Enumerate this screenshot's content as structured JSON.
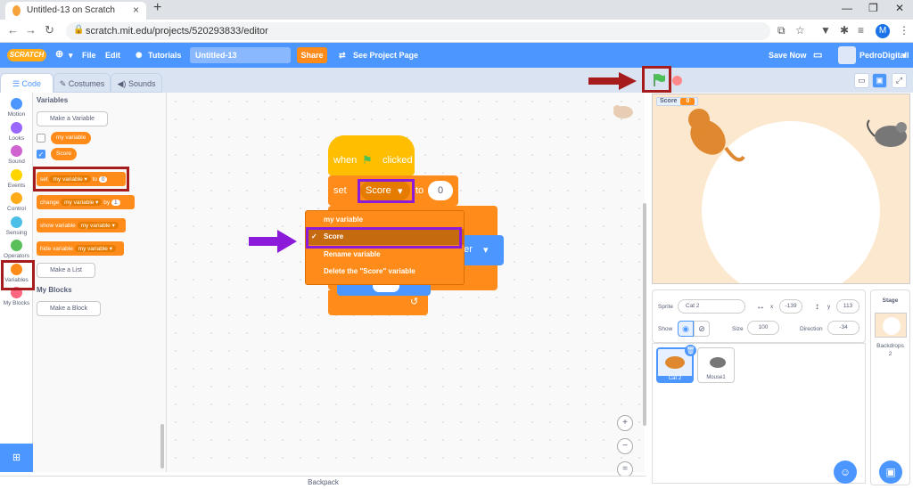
{
  "browser": {
    "tab_title": "Untitled-13 on Scratch",
    "tab_close": "×",
    "new_tab": "+",
    "minimize": "—",
    "restore": "❐",
    "close": "✕",
    "url": "scratch.mit.edu/projects/520293833/editor",
    "profile_initial": "M"
  },
  "menubar": {
    "logo": "SCRATCH",
    "file": "File",
    "edit": "Edit",
    "tutorials": "Tutorials",
    "project_name": "Untitled-13",
    "share": "Share",
    "see_project": "See Project Page",
    "save_now": "Save Now",
    "username": "PedroDigitall"
  },
  "editor_tabs": {
    "code": "Code",
    "costumes": "Costumes",
    "sounds": "Sounds"
  },
  "categories": [
    {
      "label": "Motion",
      "color": "#4c97ff"
    },
    {
      "label": "Looks",
      "color": "#9966ff"
    },
    {
      "label": "Sound",
      "color": "#cf63cf"
    },
    {
      "label": "Events",
      "color": "#ffd500"
    },
    {
      "label": "Control",
      "color": "#ffab19"
    },
    {
      "label": "Sensing",
      "color": "#4cbfe6"
    },
    {
      "label": "Operators",
      "color": "#59c059"
    },
    {
      "label": "Variables",
      "color": "#ff8c1a"
    },
    {
      "label": "My Blocks",
      "color": "#ff6680"
    }
  ],
  "palette": {
    "variables_title": "Variables",
    "make_variable": "Make a Variable",
    "var1": "my variable",
    "var2": "Score",
    "set_word": "set",
    "set_var": "my variable",
    "to_word": "to",
    "set_value": "0",
    "change_word": "change",
    "change_var": "my variable",
    "by_word": "by",
    "change_value": "1",
    "show_word": "show variable",
    "show_var": "my variable",
    "hide_word": "hide variable",
    "hide_var": "my variable",
    "make_list": "Make a List",
    "myblocks_title": "My Blocks",
    "make_block": "Make a Block"
  },
  "script": {
    "when": "when",
    "clicked": "clicked",
    "set": "set",
    "variable": "Score",
    "to": "to",
    "value": "0",
    "goto_partial": "nter"
  },
  "dropdown": {
    "items": [
      {
        "label": "my variable",
        "check": ""
      },
      {
        "label": "Score",
        "check": "✓"
      },
      {
        "label": "Rename variable",
        "check": ""
      },
      {
        "label": "Delete the \"Score\" variable",
        "check": ""
      }
    ]
  },
  "stage": {
    "monitor_label": "Score",
    "monitor_value": "0"
  },
  "sprite_info": {
    "sprite_label": "Sprite",
    "sprite_name": "Cat 2",
    "x_label": "x",
    "x_value": "-139",
    "y_label": "y",
    "y_value": "113",
    "show_label": "Show",
    "size_label": "Size",
    "size_value": "100",
    "direction_label": "Direction",
    "direction_value": "-34"
  },
  "sprites": [
    {
      "name": "Cat 2"
    },
    {
      "name": "Mouse1"
    }
  ],
  "stage_panel": {
    "title": "Stage",
    "backdrops_label": "Backdrops",
    "backdrops_count": "2"
  },
  "backpack": "Backpack",
  "zoom": {
    "in": "+",
    "out": "−",
    "reset": "="
  }
}
